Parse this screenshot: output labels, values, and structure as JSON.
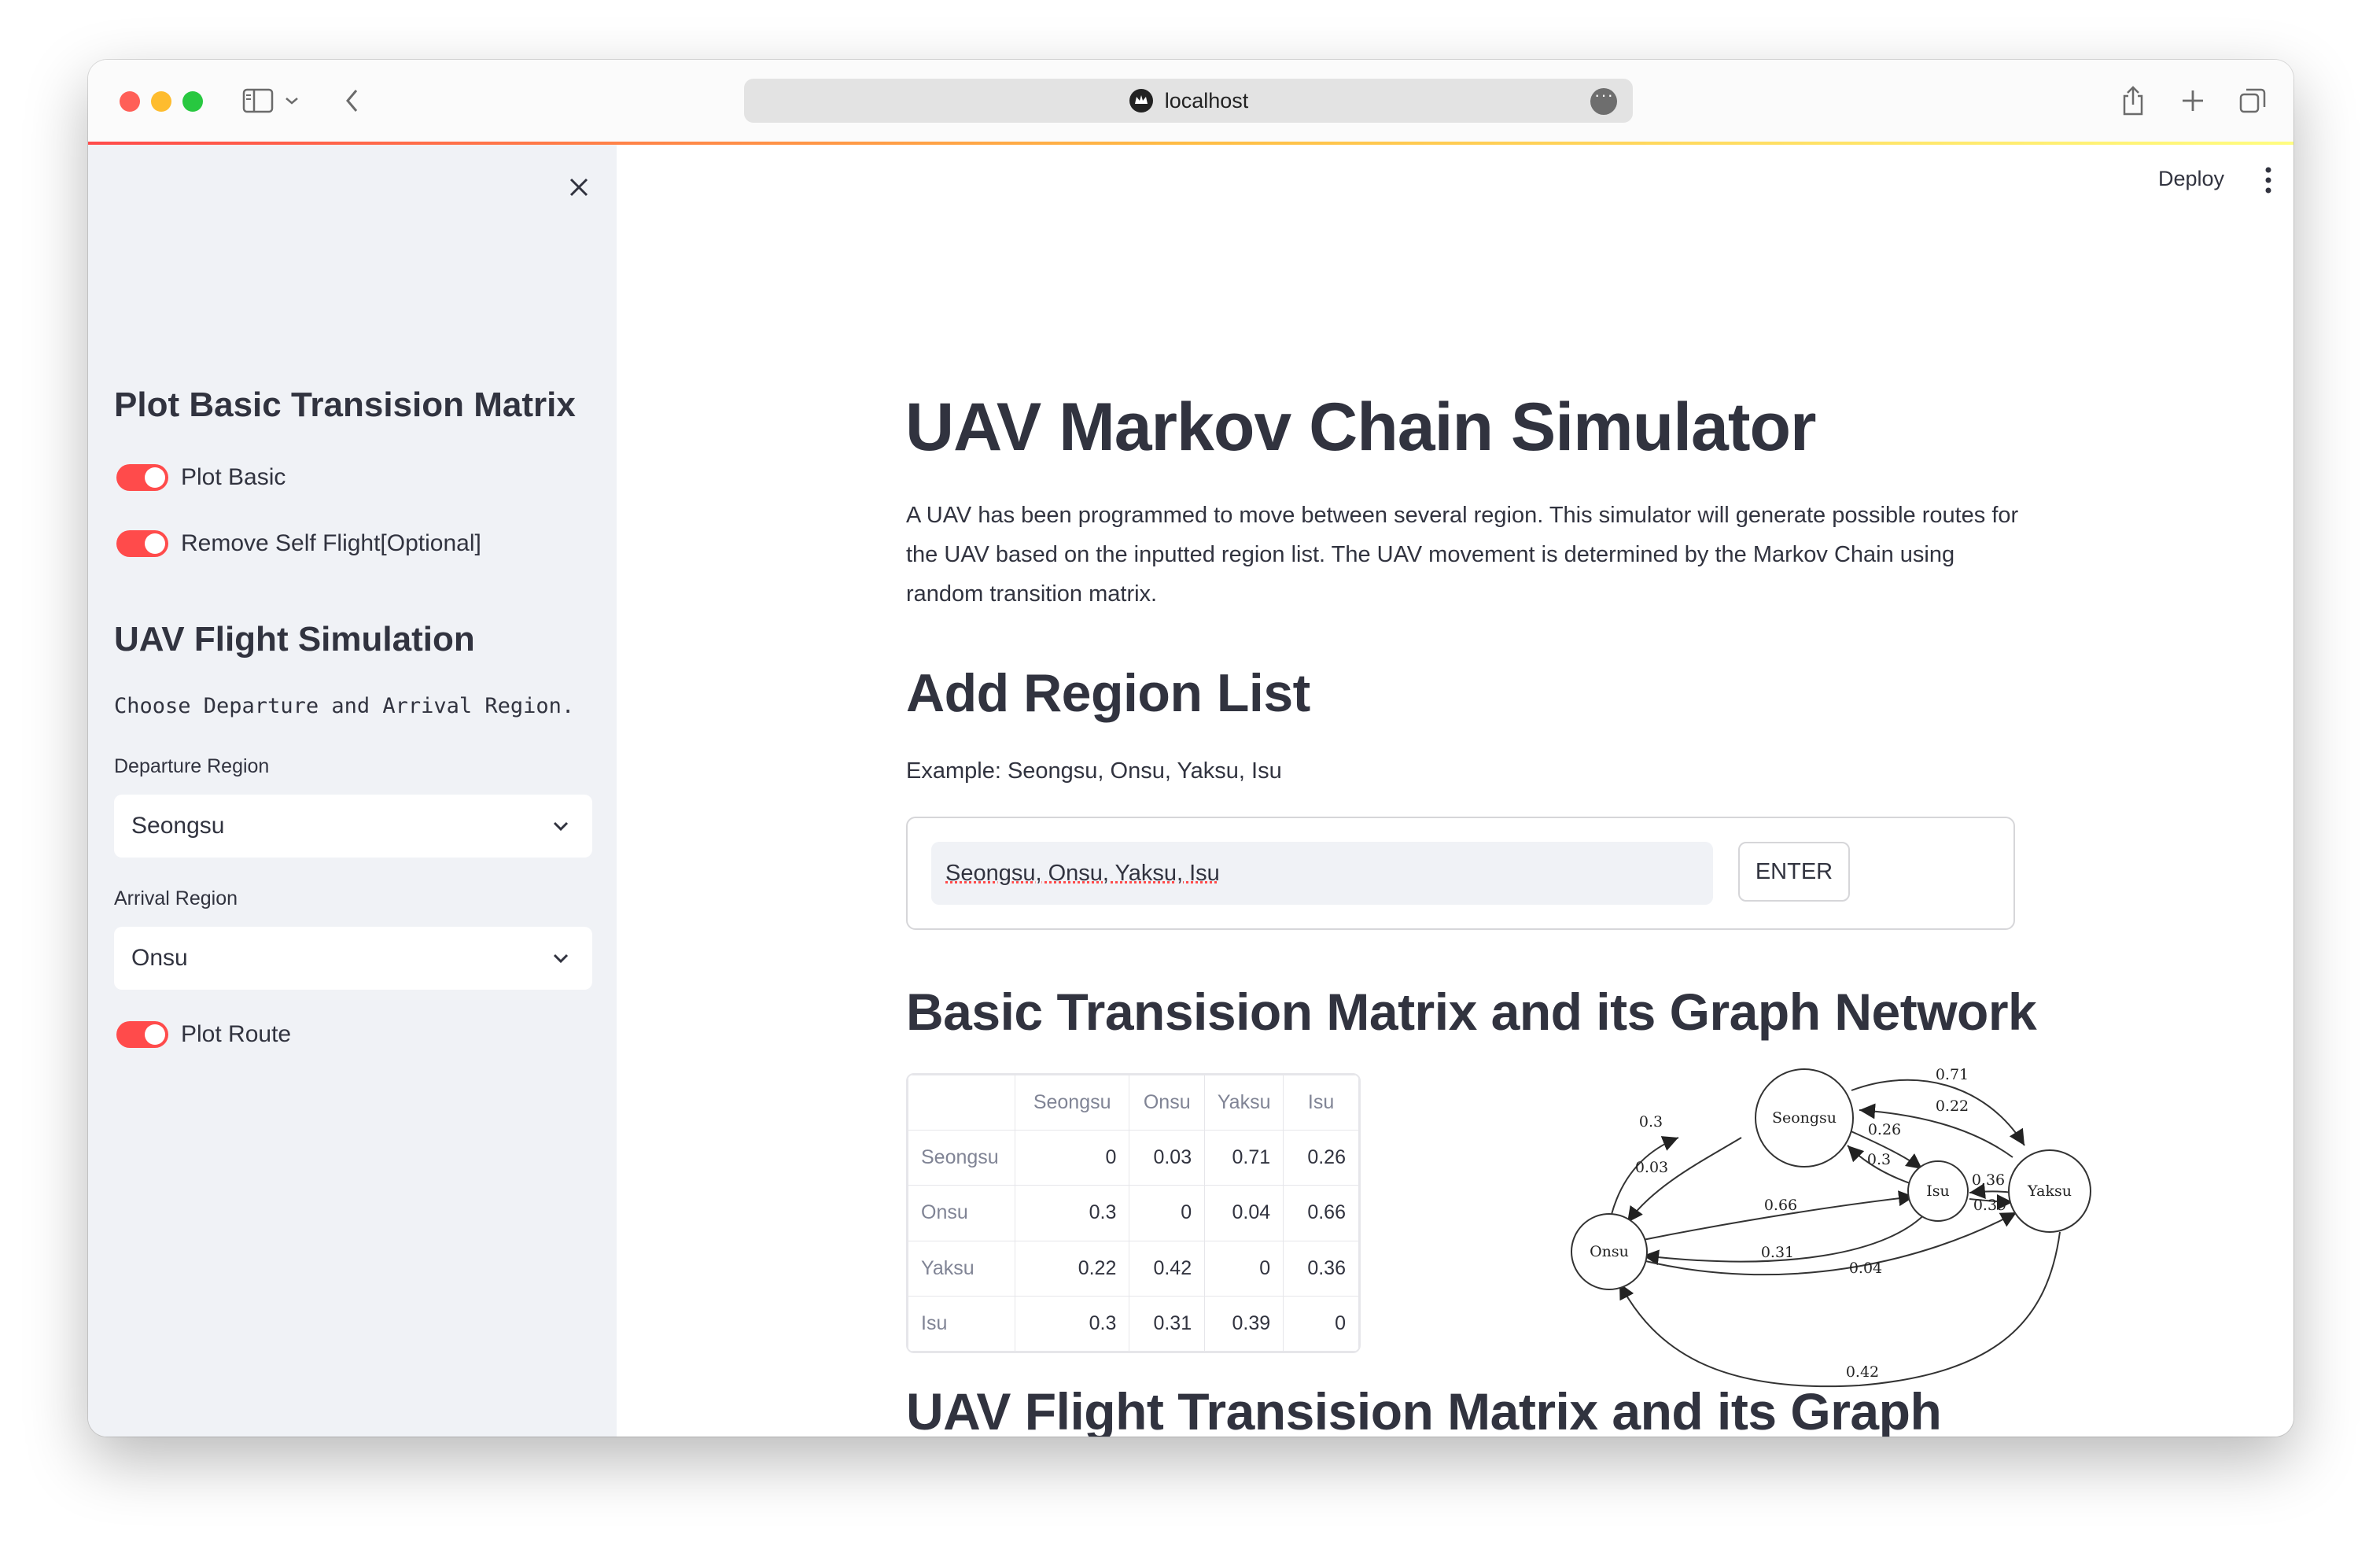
{
  "browser": {
    "url": "localhost"
  },
  "sidebar": {
    "section1_title": "Plot Basic Transision Matrix",
    "toggle_plot_basic": "Plot Basic",
    "toggle_remove_self": "Remove Self Flight[Optional]",
    "section2_title": "UAV Flight Simulation",
    "instruction": "Choose Departure and Arrival Region.",
    "departure_label": "Departure Region",
    "departure_value": "Seongsu",
    "arrival_label": "Arrival Region",
    "arrival_value": "Onsu",
    "toggle_plot_route": "Plot Route"
  },
  "header": {
    "deploy": "Deploy"
  },
  "main": {
    "title": "UAV Markov Chain Simulator",
    "description": "A UAV has been programmed to move between several region. This simulator will generate possible routes for the UAV based on the inputted region list. The UAV movement is determined by the Markov Chain using random transition matrix.",
    "add_region_title": "Add Region List",
    "example": "Example: Seongsu, Onsu, Yaksu, Isu",
    "region_input_value": "Seongsu, Onsu, Yaksu, Isu",
    "enter_button": "ENTER",
    "basic_matrix_title": "Basic Transision Matrix and its Graph Network",
    "flight_matrix_title": "UAV Flight Transision Matrix and its Graph"
  },
  "matrix": {
    "columns": [
      "Seongsu",
      "Onsu",
      "Yaksu",
      "Isu"
    ],
    "rows": [
      {
        "label": "Seongsu",
        "values": [
          "0",
          "0.03",
          "0.71",
          "0.26"
        ]
      },
      {
        "label": "Onsu",
        "values": [
          "0.3",
          "0",
          "0.04",
          "0.66"
        ]
      },
      {
        "label": "Yaksu",
        "values": [
          "0.22",
          "0.42",
          "0",
          "0.36"
        ]
      },
      {
        "label": "Isu",
        "values": [
          "0.3",
          "0.31",
          "0.39",
          "0"
        ]
      }
    ]
  },
  "graph": {
    "nodes": [
      "Seongsu",
      "Onsu",
      "Yaksu",
      "Isu"
    ],
    "edge_labels": {
      "seongsu_yaksu": "0.71",
      "yaksu_seongsu": "0.22",
      "seongsu_isu": "0.26",
      "isu_seongsu": "0.3",
      "onsu_seongsu": "0.3",
      "seongsu_onsu": "0.03",
      "onsu_isu": "0.66",
      "isu_onsu": "0.31",
      "yaksu_isu": "0.36",
      "isu_yaksu": "0.39",
      "onsu_yaksu": "0.04",
      "yaksu_onsu": "0.42"
    }
  }
}
